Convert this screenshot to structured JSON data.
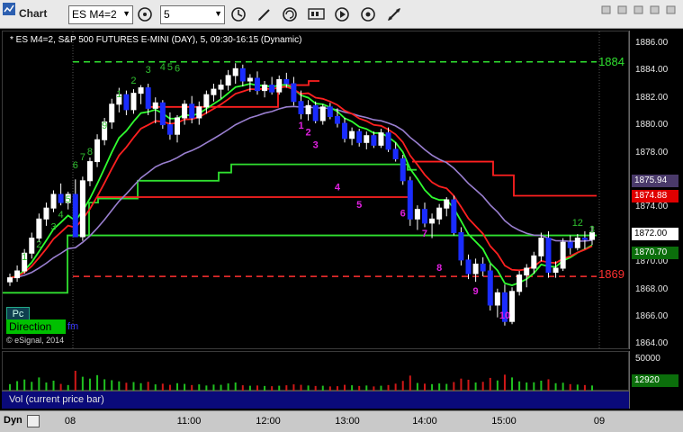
{
  "window": {
    "title": "Chart"
  },
  "toolbar": {
    "symbol": "ES M4=2",
    "interval": "5",
    "icons": [
      "cursor-icon",
      "clock-icon",
      "pencil-icon",
      "refresh-icon",
      "studies-icon",
      "play-icon",
      "settings-icon",
      "link-icon"
    ]
  },
  "chart": {
    "header": "* ES M4=2, S&P 500 FUTURES E-MINI (DAY), 5, 09:30-16:15 (Dynamic)",
    "level_high_label": "1884",
    "level_low_label": "1869",
    "pc_label": "Pc",
    "direction_label": "Direction",
    "direction_suffix": "fm",
    "copyright": "© eSignal, 2014"
  },
  "price_axis": {
    "ticks": [
      "1886.00",
      "1884.00",
      "1882.00",
      "1880.00",
      "1878.00",
      "1876.00",
      "1874.00",
      "1872.00",
      "1870.00",
      "1868.00",
      "1866.00",
      "1864.00"
    ],
    "tag_purple": "1875.94",
    "tag_red": "1874.88",
    "tag_white": "1872.00",
    "tag_green": "1870.70",
    "colors": {
      "purple": "#9a7fd0",
      "red": "#ff2020",
      "white": "#ffffff",
      "green": "#30e030"
    }
  },
  "volume": {
    "label": "Vol (current price bar)",
    "axis_max": "50000",
    "axis_current": "12920"
  },
  "time_axis": {
    "labels": [
      "08",
      "11:00",
      "12:00",
      "13:00",
      "14:00",
      "15:00",
      "09"
    ]
  },
  "footer": {
    "mode": "Dyn"
  },
  "chart_data": {
    "type": "candlestick",
    "title": "* ES M4=2, S&P 500 FUTURES E-MINI (DAY), 5, 09:30-16:15 (Dynamic)",
    "ylim": [
      1864,
      1887
    ],
    "x_labels": [
      "08",
      "11:00",
      "12:00",
      "13:00",
      "14:00",
      "15:00",
      "09"
    ],
    "levels": [
      {
        "value": 1884.7,
        "label": "1884",
        "color": "#30e030"
      },
      {
        "value": 1869.0,
        "label": "1869",
        "color": "#ff3030"
      }
    ],
    "candles": [
      [
        1868.6,
        1869.2,
        1868.3,
        1868.9
      ],
      [
        1868.9,
        1869.8,
        1868.6,
        1869.4
      ],
      [
        1869.4,
        1871.0,
        1869.2,
        1870.7
      ],
      [
        1870.7,
        1872.2,
        1870.3,
        1871.8
      ],
      [
        1871.8,
        1873.6,
        1871.5,
        1873.2
      ],
      [
        1873.2,
        1874.4,
        1872.7,
        1874.0
      ],
      [
        1874.0,
        1875.3,
        1873.7,
        1875.0
      ],
      [
        1875.0,
        1875.8,
        1874.2,
        1874.4
      ],
      [
        1874.4,
        1875.2,
        1873.9,
        1875.0
      ],
      [
        1875.0,
        1876.1,
        1872.8,
        1871.9
      ],
      [
        1871.9,
        1876.3,
        1871.6,
        1876.0
      ],
      [
        1876.0,
        1877.7,
        1875.6,
        1877.4
      ],
      [
        1877.4,
        1879.4,
        1877.0,
        1879.0
      ],
      [
        1879.0,
        1880.6,
        1878.6,
        1880.3
      ],
      [
        1880.3,
        1882.0,
        1879.8,
        1881.6
      ],
      [
        1881.6,
        1882.8,
        1881.0,
        1882.3
      ],
      [
        1882.3,
        1882.6,
        1880.8,
        1881.2
      ],
      [
        1881.2,
        1882.7,
        1880.9,
        1882.4
      ],
      [
        1882.4,
        1883.0,
        1881.6,
        1882.8
      ],
      [
        1882.8,
        1883.1,
        1880.8,
        1881.3
      ],
      [
        1881.3,
        1882.1,
        1880.2,
        1881.7
      ],
      [
        1881.7,
        1881.9,
        1879.8,
        1880.1
      ],
      [
        1880.1,
        1881.0,
        1879.0,
        1879.4
      ],
      [
        1879.4,
        1880.8,
        1878.8,
        1880.6
      ],
      [
        1880.6,
        1881.9,
        1880.1,
        1881.6
      ],
      [
        1881.6,
        1882.2,
        1880.2,
        1880.6
      ],
      [
        1880.6,
        1881.8,
        1880.1,
        1881.4
      ],
      [
        1881.4,
        1882.6,
        1880.9,
        1882.3
      ],
      [
        1882.3,
        1883.1,
        1881.8,
        1882.7
      ],
      [
        1882.7,
        1883.4,
        1882.0,
        1883.0
      ],
      [
        1883.0,
        1884.1,
        1882.6,
        1883.7
      ],
      [
        1883.7,
        1884.6,
        1883.1,
        1884.2
      ],
      [
        1884.2,
        1884.5,
        1882.9,
        1883.3
      ],
      [
        1883.3,
        1883.8,
        1882.5,
        1883.5
      ],
      [
        1883.5,
        1884.0,
        1882.3,
        1882.6
      ],
      [
        1882.6,
        1883.3,
        1882.1,
        1883.0
      ],
      [
        1883.0,
        1883.6,
        1882.3,
        1882.5
      ],
      [
        1882.5,
        1883.7,
        1882.3,
        1883.4
      ],
      [
        1883.4,
        1883.9,
        1882.8,
        1883.1
      ],
      [
        1883.1,
        1883.6,
        1881.5,
        1881.8
      ],
      [
        1881.8,
        1882.6,
        1880.5,
        1880.9
      ],
      [
        1880.9,
        1881.9,
        1880.4,
        1881.5
      ],
      [
        1881.5,
        1881.8,
        1880.2,
        1880.4
      ],
      [
        1880.4,
        1881.6,
        1880.1,
        1881.4
      ],
      [
        1881.4,
        1881.7,
        1880.5,
        1880.7
      ],
      [
        1880.7,
        1881.3,
        1879.9,
        1880.2
      ],
      [
        1880.2,
        1880.6,
        1878.8,
        1879.1
      ],
      [
        1879.1,
        1879.9,
        1878.6,
        1879.6
      ],
      [
        1879.6,
        1879.8,
        1878.5,
        1878.8
      ],
      [
        1878.8,
        1879.6,
        1878.3,
        1879.3
      ],
      [
        1879.3,
        1879.6,
        1878.4,
        1878.6
      ],
      [
        1878.6,
        1879.8,
        1878.4,
        1879.5
      ],
      [
        1879.5,
        1879.9,
        1878.1,
        1878.3
      ],
      [
        1878.3,
        1878.8,
        1877.4,
        1877.6
      ],
      [
        1877.6,
        1877.9,
        1875.7,
        1876.0
      ],
      [
        1876.0,
        1876.3,
        1872.7,
        1873.2
      ],
      [
        1873.2,
        1874.2,
        1872.4,
        1873.9
      ],
      [
        1873.9,
        1874.4,
        1872.6,
        1872.9
      ],
      [
        1872.9,
        1873.6,
        1871.8,
        1873.2
      ],
      [
        1873.2,
        1874.3,
        1872.8,
        1874.0
      ],
      [
        1874.0,
        1874.8,
        1873.4,
        1874.6
      ],
      [
        1874.6,
        1874.9,
        1872.0,
        1872.2
      ],
      [
        1872.2,
        1872.6,
        1869.8,
        1870.2
      ],
      [
        1870.2,
        1870.6,
        1868.8,
        1869.2
      ],
      [
        1869.2,
        1870.3,
        1868.6,
        1869.9
      ],
      [
        1869.9,
        1870.4,
        1869.0,
        1869.4
      ],
      [
        1869.4,
        1869.9,
        1866.5,
        1866.9
      ],
      [
        1866.9,
        1868.1,
        1866.0,
        1867.8
      ],
      [
        1867.8,
        1868.4,
        1865.4,
        1865.7
      ],
      [
        1865.7,
        1868.2,
        1865.5,
        1867.9
      ],
      [
        1867.9,
        1869.4,
        1867.6,
        1869.1
      ],
      [
        1869.1,
        1869.9,
        1868.2,
        1869.6
      ],
      [
        1869.6,
        1870.8,
        1869.2,
        1870.5
      ],
      [
        1870.5,
        1872.2,
        1870.1,
        1871.8
      ],
      [
        1871.8,
        1872.3,
        1868.9,
        1869.3
      ],
      [
        1869.3,
        1870.1,
        1868.9,
        1869.6
      ],
      [
        1869.6,
        1871.8,
        1869.4,
        1871.5
      ],
      [
        1871.5,
        1872.0,
        1870.6,
        1871.1
      ],
      [
        1871.1,
        1872.1,
        1870.9,
        1871.8
      ],
      [
        1871.8,
        1872.3,
        1871.0,
        1871.7
      ],
      [
        1871.7,
        1872.7,
        1871.3,
        1872.2
      ]
    ],
    "volumes": [
      3200,
      4500,
      5200,
      4200,
      6100,
      3900,
      4700,
      3300,
      2800,
      9000,
      6400,
      5600,
      7100,
      5300,
      4900,
      4400,
      3800,
      4100,
      3600,
      4200,
      3100,
      3400,
      2900,
      3600,
      3300,
      2800,
      3100,
      2600,
      3000,
      2900,
      3500,
      3900,
      2700,
      2500,
      2600,
      2400,
      2300,
      2500,
      2700,
      3100,
      2900,
      2600,
      2400,
      2500,
      2200,
      2300,
      2900,
      2700,
      2400,
      2600,
      2200,
      2500,
      2800,
      3400,
      4600,
      6900,
      3700,
      3400,
      3200,
      3500,
      3300,
      4100,
      5600,
      5100,
      3900,
      4200,
      5900,
      4800,
      7300,
      6100,
      4400,
      3900,
      4000,
      4700,
      5300,
      3600,
      3800,
      3200,
      3000,
      2800,
      2600
    ],
    "indicator_labels": [
      "1",
      "2",
      "3",
      "4",
      "5",
      "6",
      "7",
      "8",
      "9",
      "1",
      "2",
      "3",
      "4",
      "5",
      "6",
      "7",
      "8",
      "9",
      "1",
      "2",
      "3",
      "4",
      "5",
      "6",
      "7",
      "8",
      "9",
      "10",
      "11",
      "12",
      "3"
    ]
  }
}
